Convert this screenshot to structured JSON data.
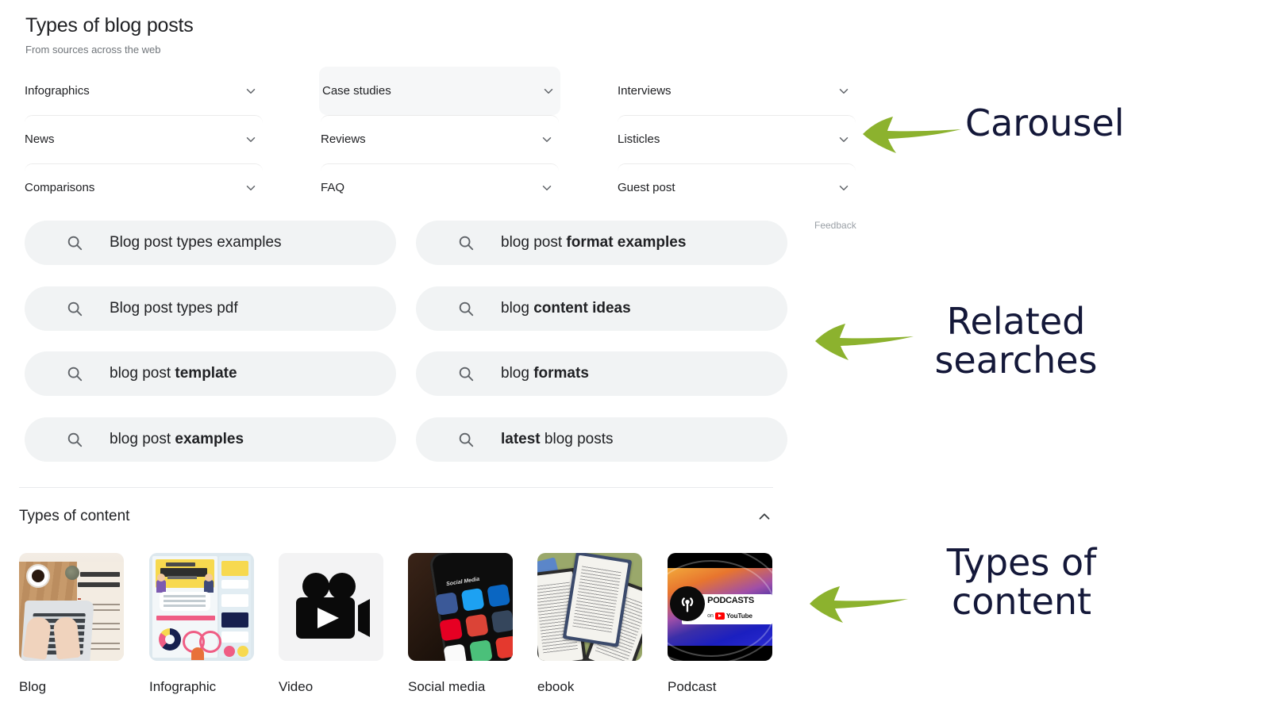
{
  "serp": {
    "title": "Types of blog posts",
    "subtitle": "From sources across the web",
    "feedback_label": "Feedback",
    "carousel": {
      "columns": [
        [
          {
            "label": "Infographics",
            "icon": "chevron-down-icon",
            "highlighted": false
          },
          {
            "label": "News",
            "icon": "chevron-down-icon",
            "highlighted": false
          },
          {
            "label": "Comparisons",
            "icon": "chevron-down-icon",
            "highlighted": false
          }
        ],
        [
          {
            "label": "Case studies",
            "icon": "chevron-down-icon",
            "highlighted": true
          },
          {
            "label": "Reviews",
            "icon": "chevron-down-icon",
            "highlighted": false
          },
          {
            "label": "FAQ",
            "icon": "chevron-down-icon",
            "highlighted": false
          }
        ],
        [
          {
            "label": "Interviews",
            "icon": "chevron-down-icon",
            "highlighted": false
          },
          {
            "label": "Listicles",
            "icon": "chevron-down-icon",
            "highlighted": false
          },
          {
            "label": "Guest post",
            "icon": "chevron-down-icon",
            "highlighted": false
          }
        ]
      ]
    },
    "related_searches": {
      "icon": "search-icon",
      "left_column": [
        {
          "plain_prefix": "Blog post types examples",
          "bold_suffix": ""
        },
        {
          "plain_prefix": "Blog post types pdf",
          "bold_suffix": ""
        },
        {
          "plain_prefix": "blog post ",
          "bold_suffix": "template"
        },
        {
          "plain_prefix": "blog post ",
          "bold_suffix": "examples"
        }
      ],
      "right_column": [
        {
          "plain_prefix": "blog post ",
          "bold_suffix": "format examples"
        },
        {
          "plain_prefix": "blog ",
          "bold_suffix": "content ideas"
        },
        {
          "plain_prefix": "blog ",
          "bold_suffix": "formats"
        },
        {
          "plain_prefix": "latest",
          "bold_suffix": " blog posts",
          "lead_bold": true
        }
      ]
    },
    "types_of_content": {
      "title": "Types of content",
      "collapse_icon": "chevron-up-icon",
      "items": [
        {
          "label": "Blog",
          "art": "blog-photo"
        },
        {
          "label": "Infographic",
          "art": "infographic-photo"
        },
        {
          "label": "Video",
          "art": "video-camera-icon"
        },
        {
          "label": "Social media",
          "art": "social-media-photo"
        },
        {
          "label": "ebook",
          "art": "ereader-photo"
        },
        {
          "label": "Podcast",
          "art": "podcasts-on-youtube-art"
        }
      ]
    }
  },
  "annotations": {
    "accent_color": "#8cb22e",
    "text_color": "#141839",
    "items": [
      {
        "text": "Carousel",
        "arrow": "left-arrow-annotation"
      },
      {
        "text": "Related\nsearches",
        "arrow": "left-arrow-annotation"
      },
      {
        "text": "Types of\ncontent",
        "arrow": "left-arrow-annotation"
      }
    ]
  }
}
